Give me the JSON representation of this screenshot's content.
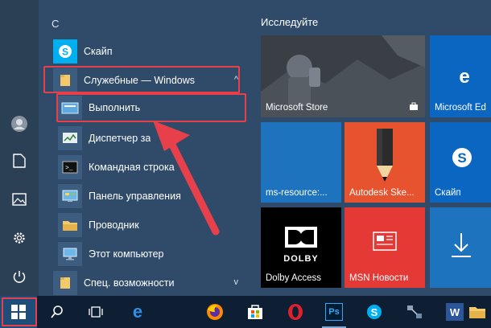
{
  "rail": {
    "items": [
      {
        "name": "user-icon"
      },
      {
        "name": "document-icon"
      },
      {
        "name": "pictures-icon"
      },
      {
        "name": "settings-gear-icon"
      },
      {
        "name": "power-icon"
      }
    ]
  },
  "applist": {
    "letter": "С",
    "items": [
      {
        "label": "Скайп",
        "icon": "skype-icon"
      },
      {
        "label": "Служебные — Windows",
        "icon": "folder-icon",
        "expanded": true
      },
      {
        "label": "Выполнить",
        "icon": "run-icon"
      },
      {
        "label": "Диспетчер за",
        "icon": "task-manager-icon"
      },
      {
        "label": "Командная строка",
        "icon": "command-prompt-icon"
      },
      {
        "label": "Панель управления",
        "icon": "control-panel-icon"
      },
      {
        "label": "Проводник",
        "icon": "explorer-icon"
      },
      {
        "label": "Этот компьютер",
        "icon": "computer-icon"
      },
      {
        "label": "Спец. возможности",
        "icon": "folder-icon"
      }
    ]
  },
  "tiles": {
    "group_title": "Исследуйте",
    "items": [
      {
        "label": "Microsoft Store"
      },
      {
        "label": "Microsoft Ed"
      },
      {
        "label": "ms-resource:..."
      },
      {
        "label": "Autodesk Ske..."
      },
      {
        "label": "Скайп"
      },
      {
        "label": "Dolby Access"
      },
      {
        "label": "MSN Новости"
      },
      {
        "label": ""
      }
    ],
    "dolby_text": "DOLBY"
  },
  "taskbar": {
    "items": [
      {
        "name": "start-button"
      },
      {
        "name": "search-icon"
      },
      {
        "name": "task-view-icon"
      },
      {
        "name": "edge-icon"
      },
      {
        "name": "firefox-icon"
      },
      {
        "name": "store-icon"
      },
      {
        "name": "opera-icon"
      },
      {
        "name": "photoshop-icon"
      },
      {
        "name": "skype-icon"
      },
      {
        "name": "network-icon"
      },
      {
        "name": "word-icon"
      },
      {
        "name": "file-explorer-icon"
      }
    ],
    "ps_text": "Ps",
    "word_text": "W"
  },
  "colors": {
    "highlight": "#e8404a",
    "accent": "#0078d7",
    "store_tile": "#2d2d2d",
    "skype_blue": "#00aff0",
    "autodesk_tile": "#e8532f",
    "msn_tile": "#e53935",
    "dolby_tile": "#000000"
  }
}
